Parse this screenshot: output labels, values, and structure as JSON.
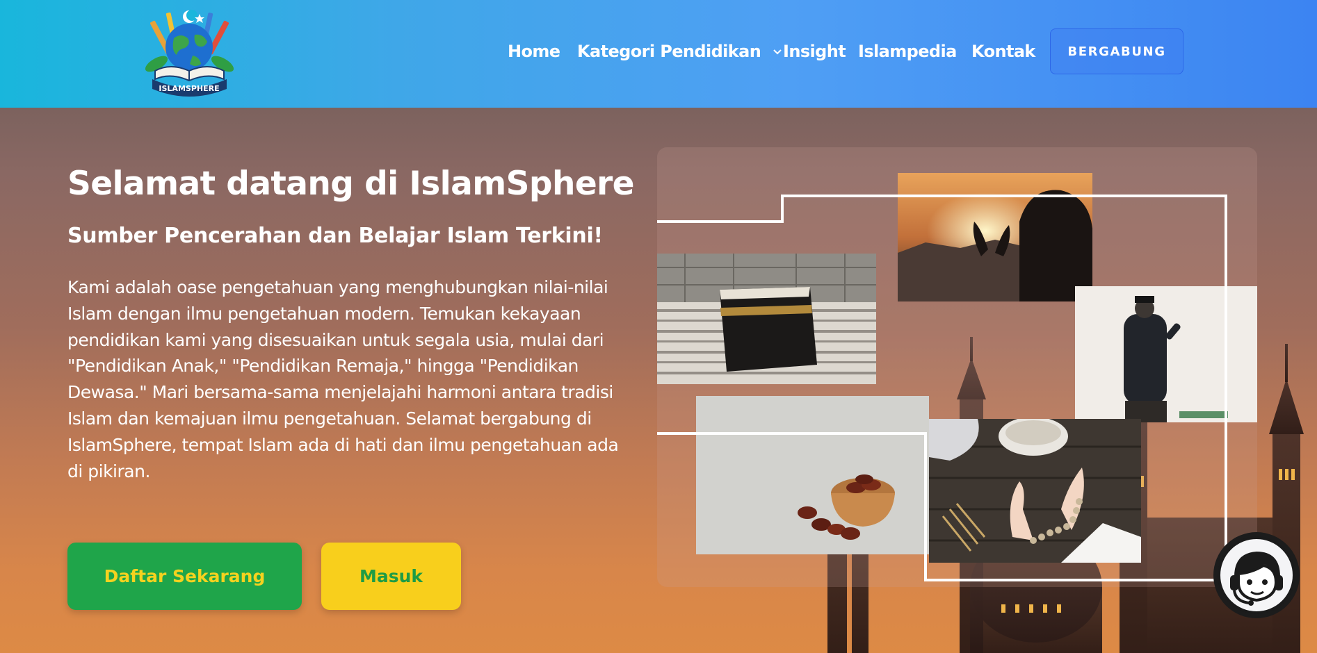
{
  "brand": {
    "logo_text": "ISLAMSPHERE",
    "logo_icon": "globe-book-logo"
  },
  "nav": {
    "items": [
      {
        "label": "Home"
      },
      {
        "label": "Kategori Pendidikan",
        "has_dropdown": true
      },
      {
        "label": "Insight"
      },
      {
        "label": "Islampedia"
      },
      {
        "label": "Kontak"
      }
    ],
    "join_label": "BERGABUNG"
  },
  "hero": {
    "title": "Selamat datang di IslamSphere",
    "subtitle": "Sumber Pencerahan dan Belajar Islam Terkini!",
    "description": "Kami adalah oase pengetahuan yang menghubungkan nilai-nilai Islam dengan ilmu pengetahuan modern. Temukan kekayaan pendidikan kami yang disesuaikan untuk segala usia, mulai dari \"Pendidikan Anak,\" \"Pendidikan Remaja,\" hingga \"Pendidikan Dewasa.\" Mari bersama-sama menjelajahi harmoni antara tradisi Islam dan kemajuan ilmu pengetahuan. Selamat bergabung di IslamSphere, tempat Islam ada di hati dan ilmu pengetahuan ada di pikiran.",
    "register_label": "Daftar Sekarang",
    "login_label": "Masuk"
  },
  "collage": {
    "photos": [
      "kaaba-photo",
      "prayer-sunset-photo",
      "man-praying-wall-photo",
      "dates-bowl-photo",
      "prayer-beads-photo"
    ]
  },
  "chat": {
    "icon": "customer-support-icon"
  },
  "colors": {
    "header_start": "#19b6dc",
    "header_end": "#3c84f2",
    "register_bg": "#1fa54a",
    "register_text": "#f5d21f",
    "login_bg": "#f8cf1c",
    "login_text": "#1e9c45"
  }
}
